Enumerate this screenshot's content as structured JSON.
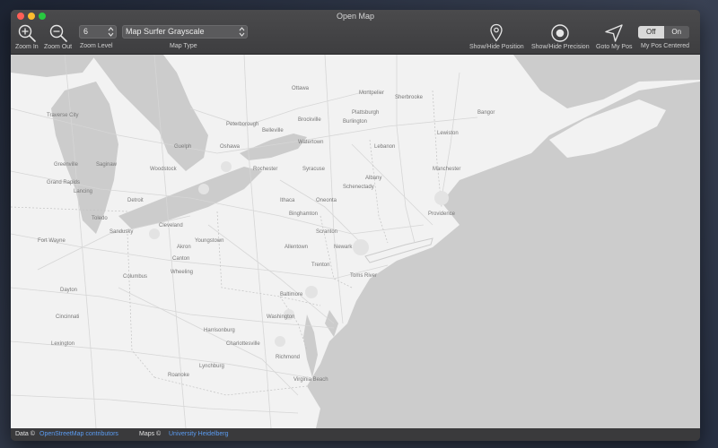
{
  "window": {
    "title": "Open Map"
  },
  "toolbar": {
    "zoom_in_label": "Zoom In",
    "zoom_out_label": "Zoom Out",
    "zoom_level_value": "6",
    "zoom_level_label": "Zoom Level",
    "map_type_value": "Map Surfer Grayscale",
    "map_type_label": "Map Type",
    "show_hide_position_label": "Show/Hide Position",
    "show_hide_precision_label": "Show/Hide Precision",
    "goto_my_pos_label": "Goto My Pos",
    "my_pos_centered_label": "My Pos Centered",
    "toggle_off_label": "Off",
    "toggle_on_label": "On",
    "toggle_selected": "Off"
  },
  "map": {
    "labels": [
      "Ottawa",
      "Montpelier",
      "Sherbrooke",
      "Bangor",
      "Burlington",
      "Plattsburgh",
      "Lewiston",
      "Traverse City",
      "Peterborough",
      "Brockville",
      "Lebanon",
      "Belleville",
      "Guelph",
      "Oshawa",
      "Greenville",
      "Saginaw",
      "Woodstock",
      "Grand Rapids",
      "Watertown",
      "Manchester",
      "Rochester",
      "Syracuse",
      "Albany",
      "Schenectady",
      "Lancing",
      "Detroit",
      "Ithaca",
      "Oneonta",
      "Providence",
      "Toledo",
      "Binghamton",
      "Sandusky",
      "Cleveland",
      "Youngstown",
      "Scranton",
      "Fort Wayne",
      "Akron",
      "Allentown",
      "Newark",
      "Canton",
      "Trenton",
      "Columbus",
      "Wheeling",
      "Toms River",
      "Dayton",
      "Cincinnati",
      "Baltimore",
      "Washington",
      "Harrisonburg",
      "Charlottesville",
      "Lexington",
      "Richmond",
      "Virginia Beach",
      "Roanoke",
      "Lynchburg"
    ],
    "colors": {
      "land": "#f2f2f2",
      "water": "#cccccc",
      "roads": "#d6d6d6",
      "city_text": "#777777"
    }
  },
  "statusbar": {
    "data_label": "Data ©",
    "data_link": "OpenStreetMap contributors",
    "maps_label": "Maps ©",
    "maps_link": "University Heidelberg"
  },
  "colors": {
    "traffic_close": "#ff5f57",
    "traffic_minimize": "#febc2e",
    "traffic_maximize": "#28c840",
    "link": "#5b9cf2"
  }
}
